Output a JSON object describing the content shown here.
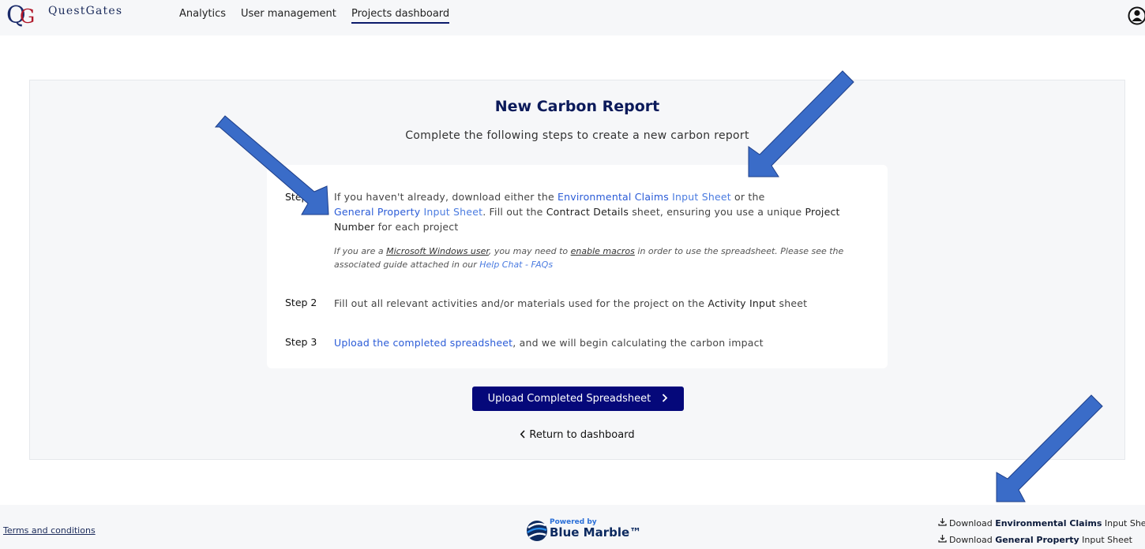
{
  "header": {
    "brand": "QuestGates",
    "nav": [
      {
        "label": "Analytics"
      },
      {
        "label": "User management"
      },
      {
        "label": "Projects dashboard"
      }
    ]
  },
  "card": {
    "title": "New Carbon Report",
    "subtitle": "Complete the following steps to create a new carbon report",
    "step1": {
      "label": "Step 1",
      "t1": "If you haven't already, download either the ",
      "link_env_claims": "Environmental Claims",
      "link_input_sheet_1": " Input Sheet",
      "t2": " or the ",
      "link_gen_property": "General Property",
      "link_input_sheet_2": " Input Sheet",
      "t3": ". Fill out the ",
      "b_contract": "Contract Details",
      "t4": " sheet, ensuring you use a unique ",
      "b_project_number": "Project Number",
      "t5": " for each project",
      "note_a": "If you are a ",
      "note_windows": "Microsoft Windows user",
      "note_b": ", you may need to ",
      "note_macros": "enable macros",
      "note_c": " in order to use the spreadsheet. Please see the associated guide attached in our ",
      "note_help": "Help Chat - FAQs"
    },
    "step2": {
      "label": "Step 2",
      "t1": "Fill out all relevant activities and/or materials used for the project on the ",
      "b_activity": "Activity Input",
      "t2": " sheet"
    },
    "step3": {
      "label": "Step 3",
      "link_upload": "Upload the completed spreadsheet",
      "t1": ", and we will begin calculating the carbon impact"
    },
    "upload_button": "Upload Completed Spreadsheet",
    "return_link": "Return to dashboard"
  },
  "footer": {
    "terms": "Terms and conditions",
    "powered_by": "Powered by",
    "powered_brand": "Blue Marble™",
    "downloads": [
      {
        "prefix": "Download ",
        "bold": "Environmental Claims",
        "suffix": " Input Sheet"
      },
      {
        "prefix": "Download ",
        "bold": "General Property",
        "suffix": " Input Sheet"
      }
    ]
  },
  "icons": {
    "logo": "questgates-logo",
    "user": "user-account-icon",
    "chevron_right": "chevron-right-icon",
    "chevron_left": "chevron-left-icon",
    "download": "download-icon",
    "blue_marble": "blue-marble-logo"
  },
  "colors": {
    "primary_button": "#05087a",
    "link": "#2a5bd7",
    "title": "#0b1a5a",
    "annotation_arrow": "#3a6cc8"
  }
}
